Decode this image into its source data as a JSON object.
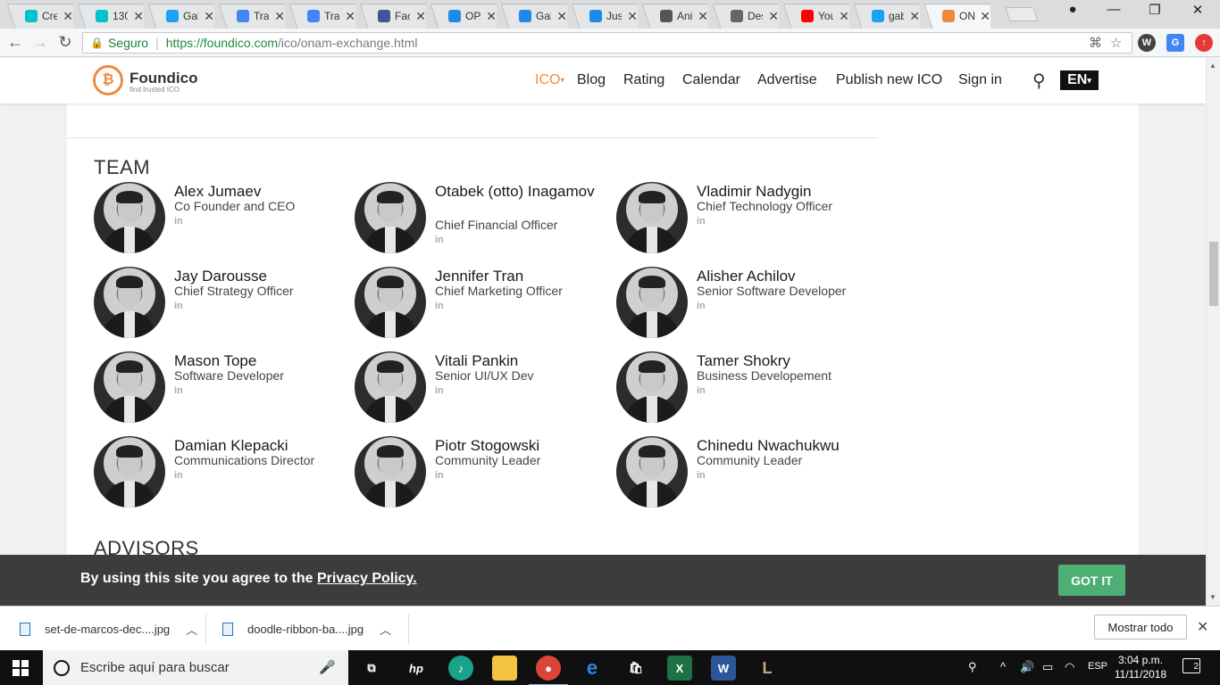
{
  "browser": {
    "tabs": [
      {
        "title": "Cre",
        "icon": "canva-icon",
        "color": "#00c4cc"
      },
      {
        "title": "130",
        "icon": "canva-icon",
        "color": "#00c4cc"
      },
      {
        "title": "Gab",
        "icon": "twitter-icon",
        "color": "#1da1f2"
      },
      {
        "title": "Trac",
        "icon": "translate-icon",
        "color": "#4285f4"
      },
      {
        "title": "Trac",
        "icon": "translate-icon",
        "color": "#4285f4"
      },
      {
        "title": "Fac",
        "icon": "facebook-icon",
        "color": "#3b5998"
      },
      {
        "title": "OPA",
        "icon": "opgg-icon",
        "color": "#1d8ae7"
      },
      {
        "title": "Gab",
        "icon": "opgg-icon",
        "color": "#1d8ae7"
      },
      {
        "title": "Just",
        "icon": "opgg-icon",
        "color": "#1d8ae7"
      },
      {
        "title": "Ani",
        "icon": "video-icon",
        "color": "#555555"
      },
      {
        "title": "Des",
        "icon": "download-icon",
        "color": "#666666"
      },
      {
        "title": "You",
        "icon": "youtube-icon",
        "color": "#ff0000"
      },
      {
        "title": "gab",
        "icon": "twitter-icon",
        "color": "#1da1f2"
      },
      {
        "title": "ON",
        "icon": "foundico-icon",
        "color": "#f08a3a"
      }
    ],
    "tab_close": "✕",
    "secure_label": "Seguro",
    "url_host": "https://foundico.com",
    "url_path": "/ico/onam-exchange.html"
  },
  "header": {
    "logo_name": "Foundico",
    "logo_tagline": "find trusted ICO",
    "nav": [
      "ICO",
      "Blog",
      "Rating",
      "Calendar",
      "Advertise",
      "Publish new ICO",
      "Sign in"
    ],
    "lang": "EN"
  },
  "team": {
    "title": "TEAM",
    "linkedin": "in",
    "members": [
      {
        "name": "Alex Jumaev",
        "role": "Co Founder and CEO"
      },
      {
        "name": "Otabek (otto) Inagamov",
        "role": "Chief Financial Officer"
      },
      {
        "name": "Vladimir Nadygin",
        "role": "Chief Technology Officer"
      },
      {
        "name": "Jay Darousse",
        "role": "Chief Strategy Officer"
      },
      {
        "name": "Jennifer Tran",
        "role": "Chief Marketing Officer"
      },
      {
        "name": "Alisher Achilov",
        "role": "Senior Software Developer"
      },
      {
        "name": "Mason Tope",
        "role": "Software Developer"
      },
      {
        "name": "Vitali Pankin",
        "role": "Senior UI/UX Dev"
      },
      {
        "name": "Tamer Shokry",
        "role": "Business Developement"
      },
      {
        "name": "Damian Klepacki",
        "role": "Communications Director"
      },
      {
        "name": "Piotr Stogowski",
        "role": "Community Leader"
      },
      {
        "name": "Chinedu Nwachukwu",
        "role": "Community Leader"
      }
    ]
  },
  "advisors": {
    "title": "ADVISORS"
  },
  "cookie": {
    "text": "By using this site you agree to the ",
    "link": "Privacy Policy.",
    "button": "GOT IT"
  },
  "downloads": {
    "items": [
      "set-de-marcos-dec....jpg",
      "doodle-ribbon-ba....jpg"
    ],
    "show_all": "Mostrar todo"
  },
  "taskbar": {
    "search_placeholder": "Escribe aquí para buscar",
    "lang": "ESP",
    "time": "3:04 p.m.",
    "date": "11/11/2018",
    "notifications": "2"
  }
}
